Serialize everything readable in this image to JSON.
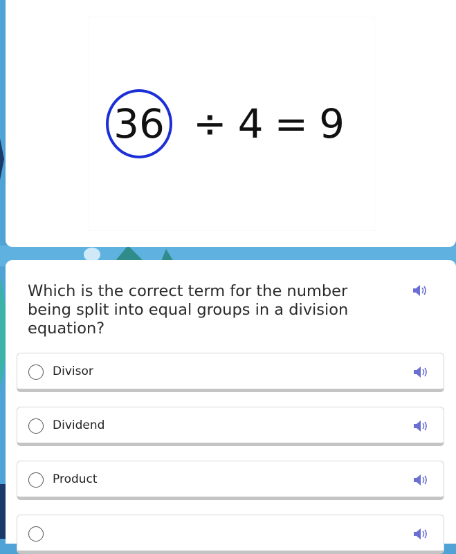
{
  "equation": {
    "dividend": "36",
    "divide_sign": "÷",
    "divisor": "4",
    "equals_sign": "=",
    "quotient": "9"
  },
  "question": {
    "text": "Which is the correct term for the number being split into equal groups in a division equation?",
    "speaker_icon": "speaker-icon"
  },
  "options": [
    {
      "label": "Divisor"
    },
    {
      "label": "Dividend"
    },
    {
      "label": "Product"
    },
    {
      "label": ""
    }
  ],
  "colors": {
    "circle": "#1c2fd6",
    "speaker": "#6a6fd1",
    "background": "#4fa3d6"
  }
}
